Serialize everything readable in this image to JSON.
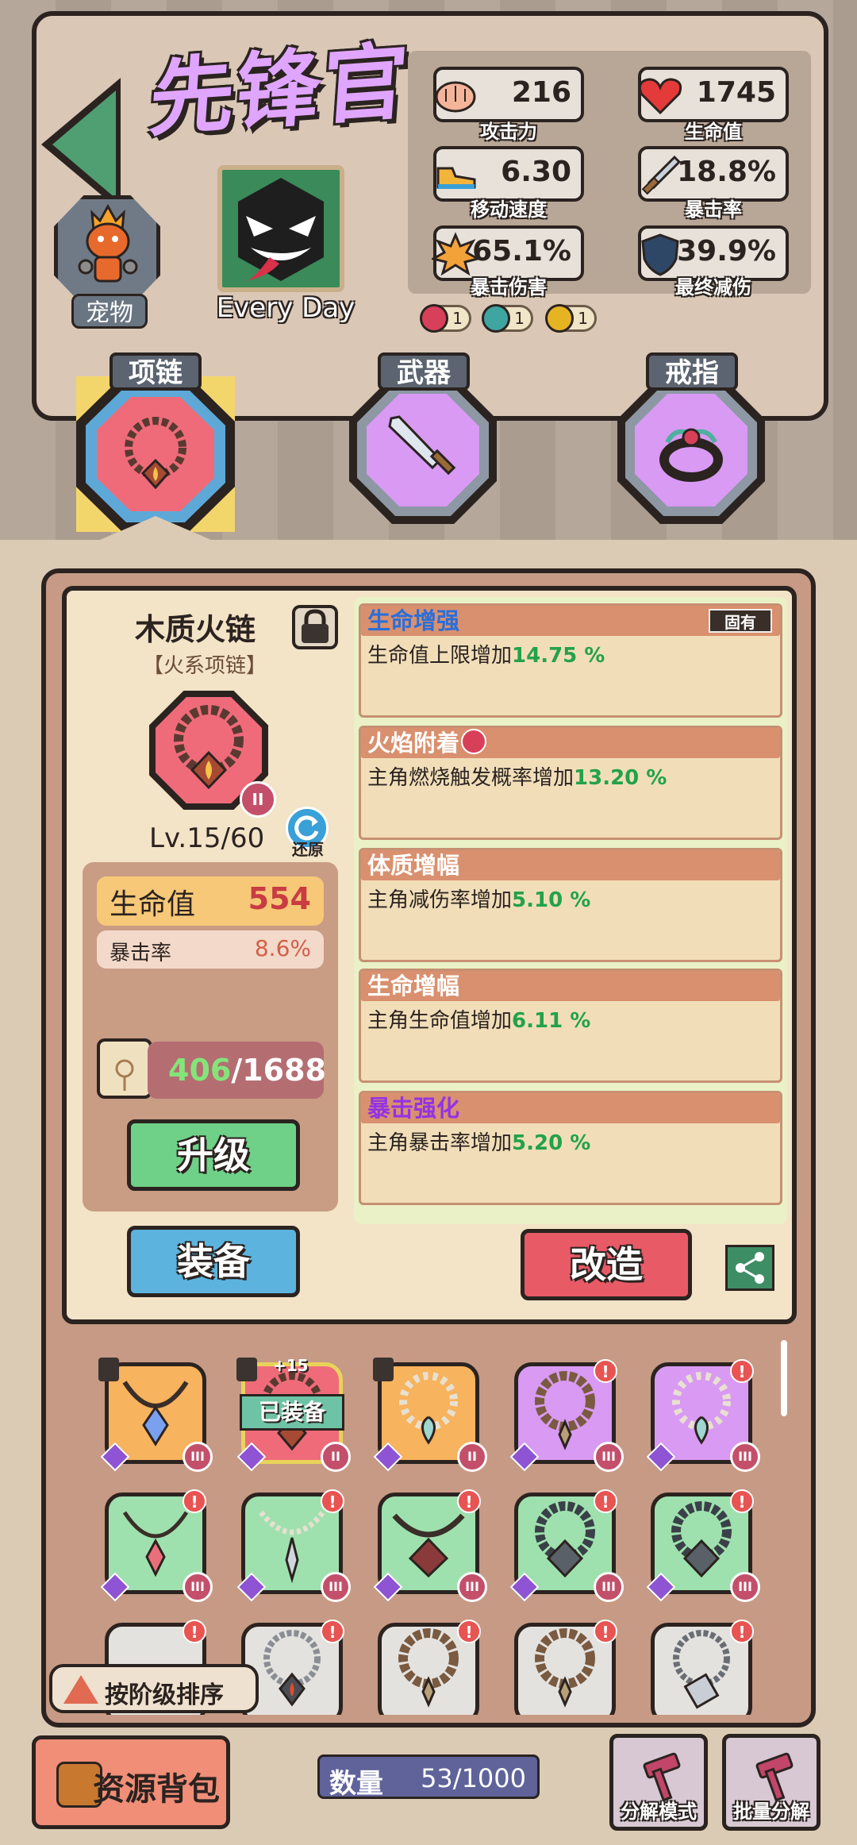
{
  "header": {
    "title": "先锋官",
    "pet_label": "宠物",
    "skin_name": "Every Day"
  },
  "stats": [
    {
      "value": "216",
      "label": "攻击力",
      "icon": "fist-icon"
    },
    {
      "value": "1745",
      "label": "生命值",
      "icon": "heart-icon"
    },
    {
      "value": "6.30",
      "label": "移动速度",
      "icon": "shoe-icon"
    },
    {
      "value": "18.8%",
      "label": "暴击率",
      "icon": "sword-icon"
    },
    {
      "value": "65.1%",
      "label": "暴击伤害",
      "icon": "explosion-icon"
    },
    {
      "value": "39.9%",
      "label": "最终减伤",
      "icon": "shield-icon"
    }
  ],
  "elements": [
    {
      "count": "1",
      "color": "#d8405a",
      "icon": "fire-element-icon"
    },
    {
      "count": "1",
      "color": "#3fa5a0",
      "icon": "wind-element-icon"
    },
    {
      "count": "1",
      "color": "#e6b422",
      "icon": "thunder-element-icon"
    }
  ],
  "categories": [
    {
      "label": "项链",
      "selected": true,
      "color": "#ef6b7a"
    },
    {
      "label": "武器",
      "selected": false,
      "color": "#d89af2"
    },
    {
      "label": "戒指",
      "selected": false,
      "color": "#d89af2"
    }
  ],
  "item": {
    "name": "木质火链",
    "type": "【火系项链】",
    "level": "Lv.15/60",
    "tier": "II",
    "restore_label": "还原",
    "main_stat": {
      "label": "生命值",
      "value": "554"
    },
    "sub_stat": {
      "label": "暴击率",
      "value": "8.6%"
    },
    "exp_current": "406",
    "exp_total": "/1688",
    "upgrade_label": "升级",
    "equip_label": "装备",
    "reform_label": "改造"
  },
  "affixes": [
    {
      "title": "生命增强",
      "tag": "固有",
      "text": "生命值上限增加",
      "value": "14.75 %",
      "style": "blue"
    },
    {
      "title": "火焰附着",
      "tag": "",
      "text": "主角燃烧触发概率增加",
      "value": "13.20 %",
      "style": "white"
    },
    {
      "title": "体质增幅",
      "tag": "",
      "text": "主角减伤率增加",
      "value": "5.10 %",
      "style": "white"
    },
    {
      "title": "生命增幅",
      "tag": "",
      "text": "主角生命值增加",
      "value": "6.11 %",
      "style": "white"
    },
    {
      "title": "暴击强化",
      "tag": "",
      "text": "主角暴击率增加",
      "value": "5.20 %",
      "style": "purple"
    }
  ],
  "inventory": {
    "equipped_label": "已装备",
    "plus_label": "+15",
    "tier_labels": [
      "III",
      "II",
      "II",
      "III",
      "III"
    ],
    "sort_label": "按阶级排序"
  },
  "footer": {
    "resource_label": "资源背包",
    "count_label": "数量",
    "count_value": "53/1000",
    "disassemble_label": "分解模式",
    "batch_label": "批量分解"
  }
}
